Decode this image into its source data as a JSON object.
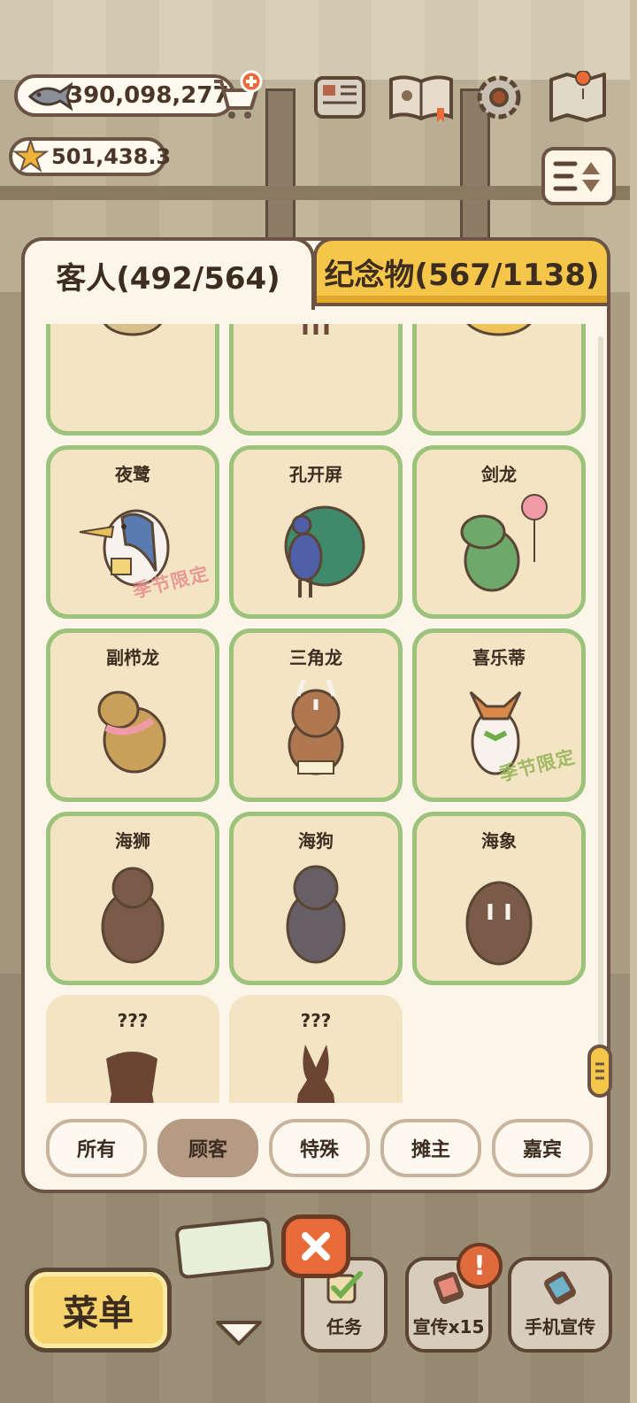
{
  "currency": {
    "fish_amount": "390,098,277",
    "star_amount": "501,438.3"
  },
  "top_icons": [
    "newspaper-icon",
    "book-icon",
    "gear-icon",
    "map-icon"
  ],
  "tabs": {
    "guests": "客人(492/564)",
    "souvenirs": "纪念物(567/1138)"
  },
  "cards": [
    {
      "name": "",
      "locked": false,
      "stamp": ""
    },
    {
      "name": "",
      "locked": false,
      "stamp": ""
    },
    {
      "name": "",
      "locked": false,
      "stamp": ""
    },
    {
      "name": "夜鹭",
      "locked": false,
      "stamp": "季节限定",
      "stamp_color": "pink"
    },
    {
      "name": "孔开屏",
      "locked": false,
      "stamp": ""
    },
    {
      "name": "剑龙",
      "locked": false,
      "stamp": ""
    },
    {
      "name": "副栉龙",
      "locked": false,
      "stamp": ""
    },
    {
      "name": "三角龙",
      "locked": false,
      "stamp": ""
    },
    {
      "name": "喜乐蒂",
      "locked": false,
      "stamp": "季节限定",
      "stamp_color": "green"
    },
    {
      "name": "海狮",
      "locked": false,
      "stamp": ""
    },
    {
      "name": "海狗",
      "locked": false,
      "stamp": ""
    },
    {
      "name": "海象",
      "locked": false,
      "stamp": ""
    },
    {
      "name": "???",
      "locked": true,
      "stamp": ""
    },
    {
      "name": "???",
      "locked": true,
      "stamp": ""
    }
  ],
  "filters": [
    {
      "label": "所有",
      "active": false
    },
    {
      "label": "顾客",
      "active": true
    },
    {
      "label": "特殊",
      "active": false
    },
    {
      "label": "摊主",
      "active": false
    },
    {
      "label": "嘉宾",
      "active": false
    }
  ],
  "bottom": {
    "menu": "菜单",
    "task": "任务",
    "promo": "宣传x15",
    "phone_promo": "手机宣传",
    "badge": "!"
  },
  "colors": {
    "card_border": "#9cc27c",
    "card_bg": "#f3e5c4",
    "tab_active_bg": "#fbf5ea",
    "tab_inactive_bg": "#f6c64a",
    "outline": "#6b5444",
    "close_button": "#ea6b3a"
  }
}
